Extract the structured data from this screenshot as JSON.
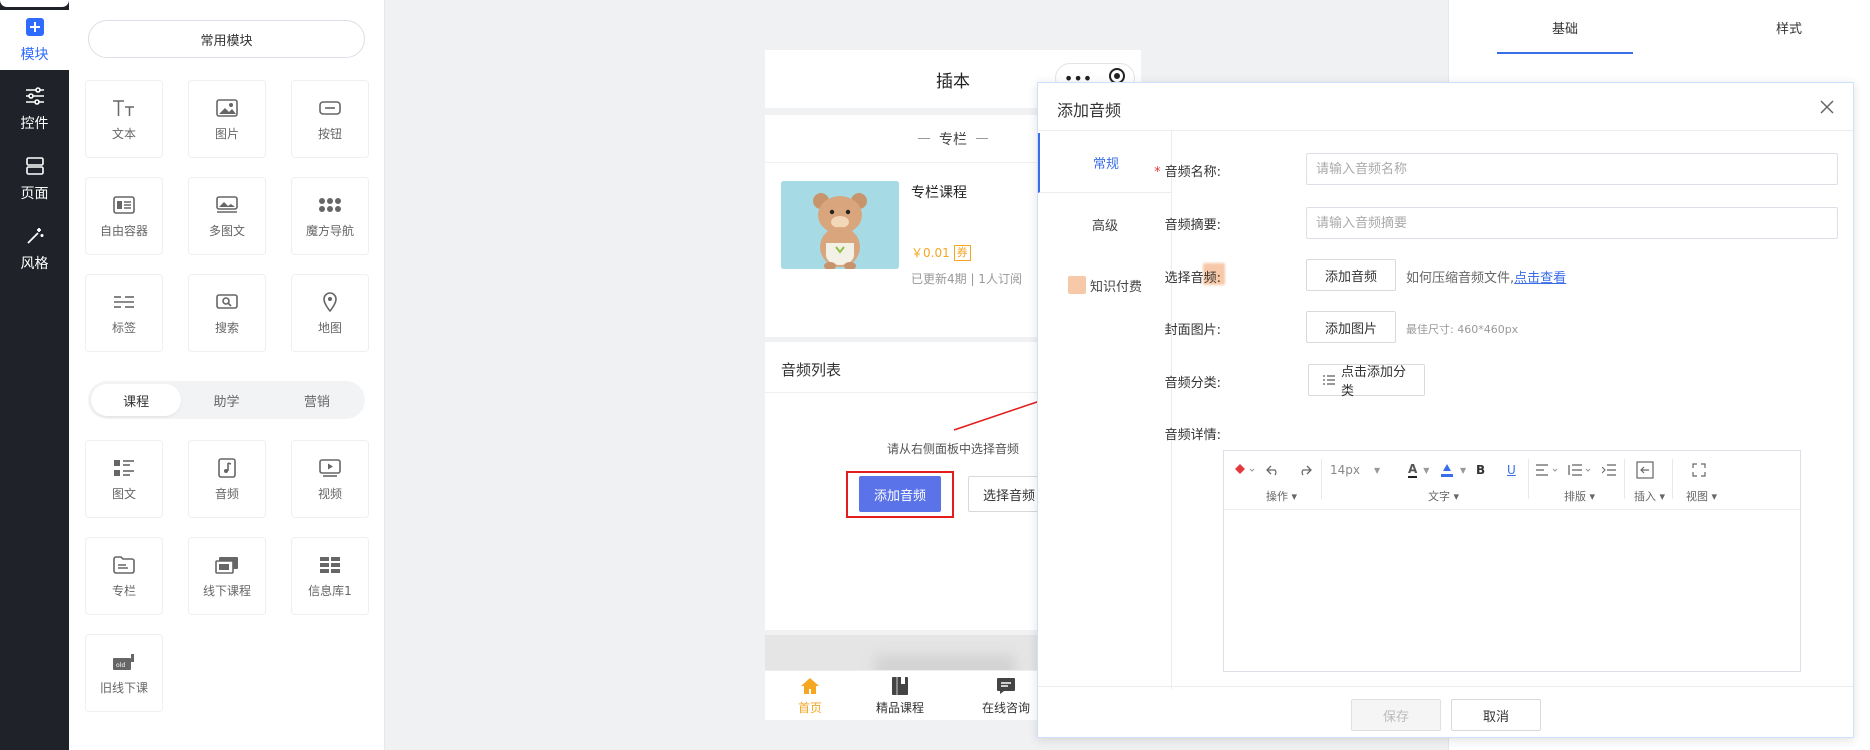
{
  "leftnav": {
    "items": [
      {
        "label": "模块",
        "icon": "plus-square-icon"
      },
      {
        "label": "控件",
        "icon": "sliders-icon"
      },
      {
        "label": "页面",
        "icon": "pages-icon"
      },
      {
        "label": "风格",
        "icon": "magic-wand-icon"
      }
    ]
  },
  "modules": {
    "common_label": "常用模块",
    "common_items": [
      {
        "label": "文本",
        "icon": "text-icon"
      },
      {
        "label": "图片",
        "icon": "image-icon"
      },
      {
        "label": "按钮",
        "icon": "button-icon"
      },
      {
        "label": "自由容器",
        "icon": "container-icon"
      },
      {
        "label": "多图文",
        "icon": "multi-image-icon"
      },
      {
        "label": "魔方导航",
        "icon": "grid-dots-icon"
      },
      {
        "label": "标签",
        "icon": "tag-icon"
      },
      {
        "label": "搜索",
        "icon": "search-icon"
      },
      {
        "label": "地图",
        "icon": "map-pin-icon"
      }
    ],
    "tabs": [
      "课程",
      "助学",
      "营销"
    ],
    "active_tab": "课程",
    "course_items": [
      {
        "label": "图文",
        "icon": "list-icon"
      },
      {
        "label": "音频",
        "icon": "audio-icon"
      },
      {
        "label": "视频",
        "icon": "video-icon"
      },
      {
        "label": "专栏",
        "icon": "folder-icon"
      },
      {
        "label": "线下课程",
        "icon": "offline-course-icon"
      },
      {
        "label": "信息库1",
        "icon": "database-grid-icon"
      },
      {
        "label": "旧线下课",
        "icon": "old-offline-course-icon"
      }
    ]
  },
  "phone": {
    "title": "插本",
    "capsule_more": "•••",
    "section_title": "专栏",
    "course": {
      "name": "专栏课程",
      "price": "￥0.01",
      "coupon": "券",
      "meta": "已更新4期 | 1人订阅"
    },
    "list_title": "音频列表",
    "empty_hint": "请从右侧面板中选择音频",
    "add_audio_btn": "添加音频",
    "select_audio_btn": "选择音频",
    "tabbar": [
      {
        "label": "首页",
        "icon": "home-icon"
      },
      {
        "label": "精品课程",
        "icon": "book-icon"
      },
      {
        "label": "在线咨询",
        "icon": "chat-icon"
      }
    ]
  },
  "right_panel": {
    "tabs": [
      "基础",
      "样式"
    ],
    "active_tab": "基础"
  },
  "dialog": {
    "title": "添加音频",
    "side_tabs": [
      "常规",
      "高级",
      "知识付费"
    ],
    "active_side_tab": "常规",
    "fields": {
      "name_label": "音频名称:",
      "name_placeholder": "请输入音频名称",
      "summary_label": "音频摘要:",
      "summary_placeholder": "请输入音频摘要",
      "select_label": "选择音频:",
      "select_btn": "添加音频",
      "select_hint": "如何压缩音频文件,",
      "select_link": "点击查看",
      "cover_label": "封面图片:",
      "cover_btn": "添加图片",
      "cover_hint": "最佳尺寸: 460*460px",
      "category_label": "音频分类:",
      "category_btn": "点击添加分类",
      "detail_label": "音频详情:"
    },
    "editor": {
      "font_size": "14px",
      "groups": [
        "操作",
        "文字",
        "排版",
        "插入",
        "视图"
      ],
      "bold": "B",
      "underline": "U",
      "font_color_glyph": "A"
    },
    "save_btn": "保存",
    "cancel_btn": "取消"
  },
  "colors": {
    "accent_blue": "#3a6ee8",
    "button_blue": "#5b73e8",
    "highlight_red": "#e41c1c",
    "price_orange": "#f5a623",
    "dark_nav": "#1f2329"
  }
}
